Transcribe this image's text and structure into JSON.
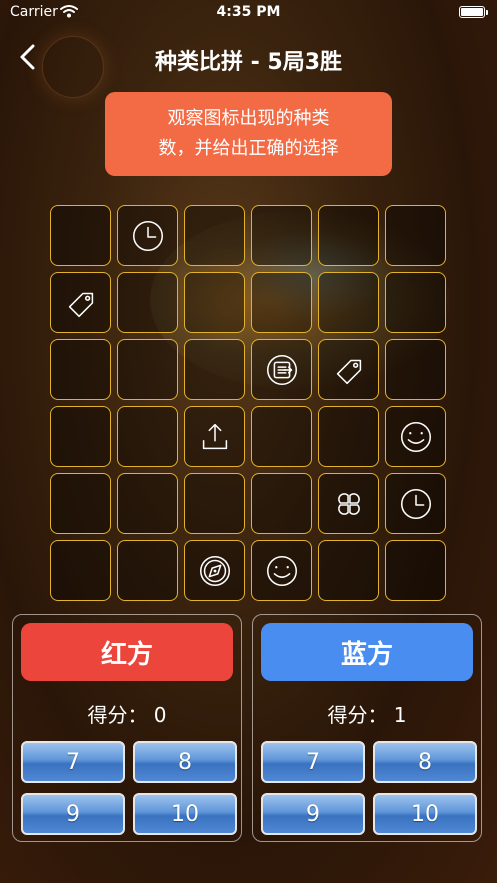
{
  "status_bar": {
    "carrier": "Carrier",
    "time": "4:35 PM"
  },
  "nav": {
    "title": "种类比拼 - 5局3胜"
  },
  "hint": {
    "line1": "观察图标出现的种类",
    "line2": "数，并给出正确的选择"
  },
  "grid": {
    "border_color": "#e2b32a",
    "rows": [
      [
        "",
        "clock-icon",
        "",
        "",
        "",
        ""
      ],
      [
        "tag-icon",
        "",
        "",
        "",
        "",
        ""
      ],
      [
        "",
        "",
        "",
        "exit-icon",
        "tag-icon",
        ""
      ],
      [
        "",
        "",
        "share-icon",
        "",
        "",
        "smile-icon"
      ],
      [
        "",
        "",
        "",
        "",
        "clover-icon",
        "clock-icon"
      ],
      [
        "",
        "",
        "compass-icon",
        "smile-icon",
        "",
        ""
      ]
    ]
  },
  "red_team": {
    "name": "红方",
    "score_text": "得分：  0",
    "color": "#ec463c",
    "options": [
      "7",
      "8",
      "9",
      "10"
    ]
  },
  "blue_team": {
    "name": "蓝方",
    "score_text": "得分：  1",
    "color": "#4a8df0",
    "options": [
      "7",
      "8",
      "9",
      "10"
    ]
  }
}
